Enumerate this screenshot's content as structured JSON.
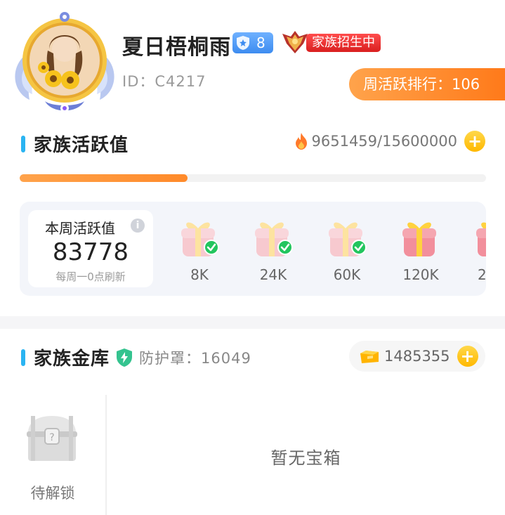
{
  "header": {
    "family_name": "夏日梧桐雨",
    "level": "8",
    "recruit_label": "家族招生中",
    "family_id": "ID：C4217",
    "weekly_rank": "周活跃排行：106"
  },
  "activity": {
    "title": "家族活跃值",
    "total": "9651459/15600000",
    "progress_fraction": 0.36,
    "weekly_label": "本周活跃值",
    "weekly_value": "83778",
    "weekly_note": "每周一0点刷新",
    "milestones": [
      {
        "amount": "8K",
        "claimed": true
      },
      {
        "amount": "24K",
        "claimed": true
      },
      {
        "amount": "60K",
        "claimed": true
      },
      {
        "amount": "120K",
        "claimed": false
      },
      {
        "amount": "2",
        "claimed": false
      }
    ]
  },
  "treasury": {
    "title": "家族金库",
    "protection": "防护罩：16049",
    "gold": "1485355",
    "chest_label": "待解锁",
    "empty_text": "暂无宝箱"
  },
  "icons": {
    "level": "shield-icon",
    "fire": "fire-icon",
    "plus": "plus-icon",
    "protection": "shield-lightning-icon",
    "gold": "gold-ingot-icon",
    "chest": "treasure-chest-icon",
    "gift": "gift-box-icon",
    "check": "check-icon",
    "info": "info-icon"
  },
  "colors": {
    "accent_blue": "#2ab4f2",
    "orange": "#ff8a2a",
    "gold": "#ffc107",
    "check_green": "#22c55e",
    "recruit_red": "#e02424"
  }
}
